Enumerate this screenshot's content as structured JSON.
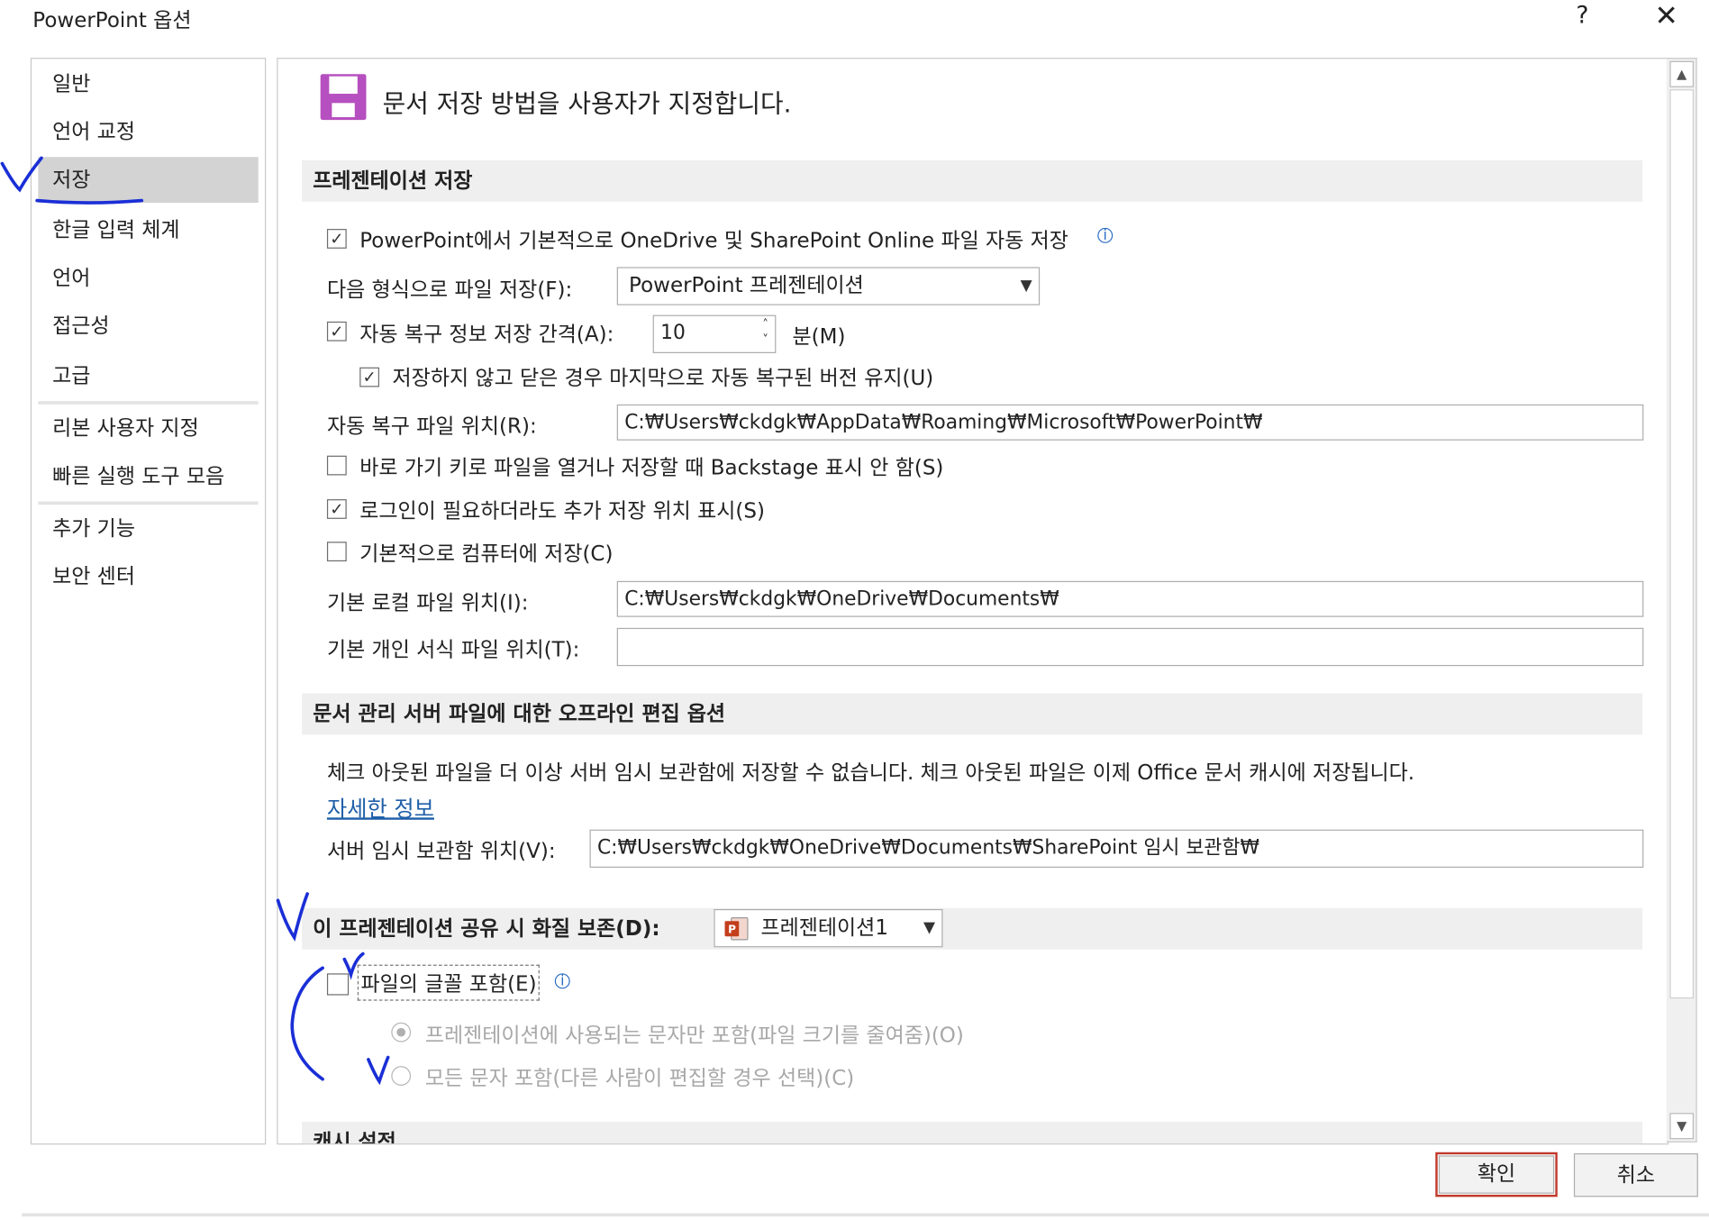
{
  "window": {
    "title": "PowerPoint 옵션",
    "help": "?",
    "close": "✕"
  },
  "sidebar": {
    "items": [
      {
        "label": "일반"
      },
      {
        "label": "언어 교정"
      },
      {
        "label": "저장"
      },
      {
        "label": "한글 입력 체계"
      },
      {
        "label": "언어"
      },
      {
        "label": "접근성"
      },
      {
        "label": "고급"
      },
      {
        "label": "리본 사용자 지정"
      },
      {
        "label": "빠른 실행 도구 모음"
      },
      {
        "label": "추가 기능"
      },
      {
        "label": "보안 센터"
      }
    ],
    "selected": "저장"
  },
  "page": {
    "heading": "문서 저장 방법을 사용자가 지정합니다.",
    "heading_icon": "save-icon"
  },
  "save_section": {
    "header": "프레젠테이션 저장",
    "autosave_label": "PowerPoint에서 기본적으로 OneDrive 및 SharePoint Online 파일 자동 저장",
    "autosave_checked": true,
    "format_label": "다음 형식으로 파일 저장(F):",
    "format_value": "PowerPoint 프레젠테이션",
    "autorecover_label": "자동 복구 정보 저장 간격(A):",
    "autorecover_checked": true,
    "autorecover_value": "10",
    "autorecover_unit": "분(M)",
    "keep_version_label": "저장하지 않고 닫은 경우 마지막으로 자동 복구된 버전 유지(U)",
    "keep_version_checked": true,
    "autorecover_location_label": "자동 복구 파일 위치(R):",
    "autorecover_location_value": "C:₩Users₩ckdgk₩AppData₩Roaming₩Microsoft₩PowerPoint₩",
    "backstage_label": "바로 가기 키로 파일을 열거나 저장할 때 Backstage 표시 안 함(S)",
    "backstage_checked": false,
    "additional_places_label": "로그인이 필요하더라도 추가 저장 위치 표시(S)",
    "additional_places_checked": true,
    "save_to_computer_label": "기본적으로 컴퓨터에 저장(C)",
    "save_to_computer_checked": false,
    "local_location_label": "기본 로컬 파일 위치(I):",
    "local_location_value": "C:₩Users₩ckdgk₩OneDrive₩Documents₩",
    "template_location_label": "기본 개인 서식 파일 위치(T):",
    "template_location_value": ""
  },
  "offline_section": {
    "header": "문서 관리 서버 파일에 대한 오프라인 편집 옵션",
    "description": "체크 아웃된 파일을 더 이상 서버 임시 보관함에 저장할 수 없습니다. 체크 아웃된 파일은 이제 Office 문서 캐시에 저장됩니다.",
    "more_info": "자세한 정보",
    "drafts_label": "서버 임시 보관함 위치(V):",
    "drafts_value": "C:₩Users₩ckdgk₩OneDrive₩Documents₩SharePoint 임시 보관함₩"
  },
  "fidelity_section": {
    "header": "이 프레젠테이션 공유 시 화질 보존(D):",
    "presentation_value": "프레젠테이션1",
    "embed_fonts_label": "파일의 글꼴 포함(E)",
    "embed_fonts_checked": false,
    "only_used_label": "프레젠테이션에 사용되는 문자만 포함(파일 크기를 줄여줌)(O)",
    "only_used_selected": true,
    "all_chars_label": "모든 문자 포함(다른 사람이 편집할 경우 선택)(C)",
    "all_chars_selected": false
  },
  "next_section": {
    "header": "캐시 설정"
  },
  "buttons": {
    "ok": "확인",
    "cancel": "취소"
  },
  "colors": {
    "accent_frame": "#c0392b",
    "annotation_ink": "#1a2fd6",
    "ppt_icon": "#c43e1c",
    "save_icon": "#b64fbf"
  }
}
